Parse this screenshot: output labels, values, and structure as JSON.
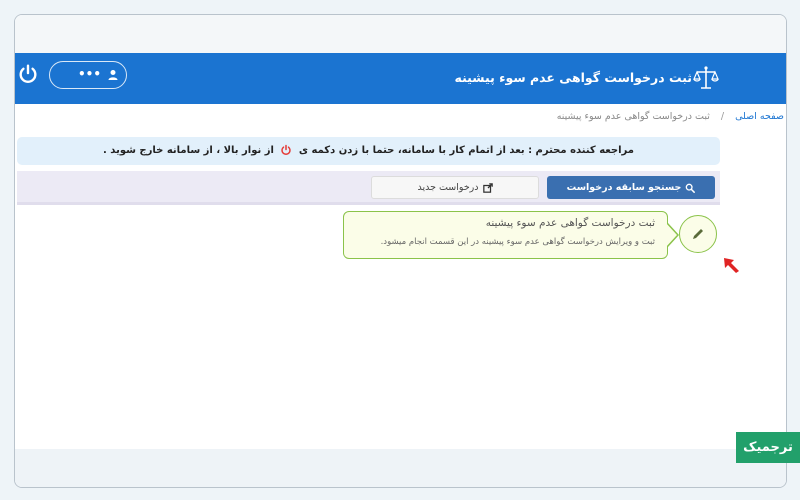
{
  "header": {
    "title": "ثبت درخواست گواهی عدم سوء پیشینه",
    "user_dots": "•••"
  },
  "breadcrumb": {
    "home": "صفحه اصلی",
    "separator": "/",
    "current": "ثبت درخواست گواهی عدم سوء پیشینه"
  },
  "notice": {
    "part1": "مراجعه کننده محترم : بعد از اتمام کار با سامانه، حتما با زدن دکمه ی",
    "part2": "از نوار بالا ، از سامانه خارج شوید ."
  },
  "tabs": {
    "search_label": "جستجو سابقه درخواست",
    "new_label": "درخواست جدید"
  },
  "card": {
    "title": "ثبت درخواست گواهی عدم سوء پیشینه",
    "description": "ثبت و ویرایش درخواست گواهی عدم سوء پیشینه در این قسمت انجام میشود."
  },
  "badge": {
    "label": "ترجمیک"
  },
  "colors": {
    "header_blue": "#1b74d1",
    "search_button": "#3a6fb0",
    "card_border": "#8bc34a",
    "power_red": "#e53935",
    "arrow_red": "#e02424",
    "badge_green": "#22a06b"
  },
  "icons": [
    "scales-of-justice-icon",
    "power-icon",
    "user-icon",
    "search-icon",
    "external-link-icon",
    "pencil-icon",
    "arrow-pointer-icon"
  ]
}
